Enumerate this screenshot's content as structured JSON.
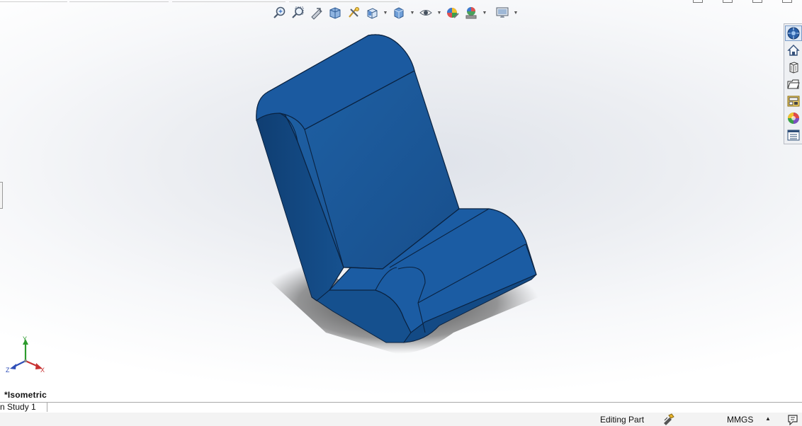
{
  "toolbar": {
    "items": [
      {
        "name": "zoom-to-fit-icon",
        "has_dropdown": false
      },
      {
        "name": "zoom-to-area-icon",
        "has_dropdown": false
      },
      {
        "name": "previous-view-icon",
        "has_dropdown": false
      },
      {
        "name": "section-view-icon",
        "has_dropdown": false
      },
      {
        "name": "dynamic-annotation-views-icon",
        "has_dropdown": false
      },
      {
        "name": "view-orientation-icon",
        "has_dropdown": true
      },
      {
        "name": "display-style-icon",
        "has_dropdown": true
      },
      {
        "name": "hide-show-items-icon",
        "has_dropdown": true
      },
      {
        "name": "edit-appearance-icon",
        "has_dropdown": false
      },
      {
        "name": "apply-scene-icon",
        "has_dropdown": true
      },
      {
        "name": "view-settings-icon",
        "has_dropdown": true
      }
    ]
  },
  "task_pane": {
    "items": [
      {
        "name": "solidworks-resources-icon"
      },
      {
        "name": "design-library-icon"
      },
      {
        "name": "file-explorer-icon"
      },
      {
        "name": "view-palette-icon"
      },
      {
        "name": "appearances-scenes-icon"
      },
      {
        "name": "custom-properties-icon"
      },
      {
        "name": "custom-properties-list-icon"
      }
    ]
  },
  "triad": {
    "y_label": "Y",
    "x_label": "X",
    "z_label": "Z",
    "colors": {
      "y": "#2d9b2d",
      "x": "#c83232",
      "z": "#2f4fb8"
    }
  },
  "view": {
    "orientation_label": "*Isometric"
  },
  "model": {
    "color": "#1a5a9c"
  },
  "tabs": {
    "study_label": "n Study 1"
  },
  "status": {
    "mode": "Editing Part",
    "units": "MMGS",
    "units_caret": "▲"
  }
}
